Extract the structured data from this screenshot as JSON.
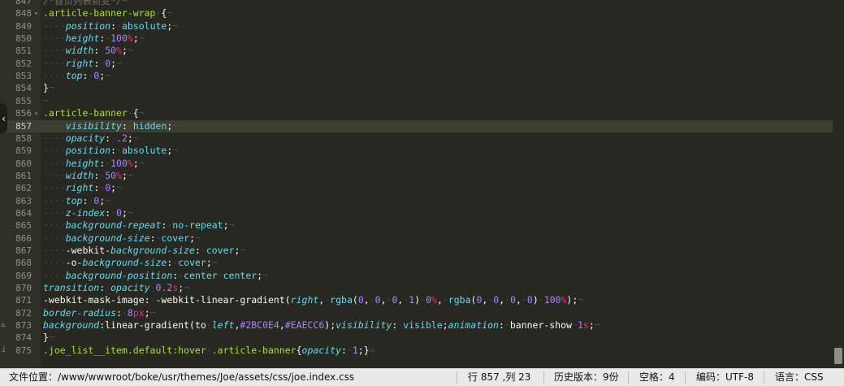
{
  "lines": [
    {
      "n": "847",
      "segs": [
        [
          "c-comment",
          "/*首页列表新变*/"
        ],
        [
          "c-ws",
          "¬"
        ]
      ]
    },
    {
      "n": "848",
      "fold": "▾",
      "segs": [
        [
          "c-sel",
          ".article-banner-wrap"
        ],
        [
          "c-ws",
          "·"
        ],
        [
          "c-plain",
          "{"
        ],
        [
          "c-ws",
          "¬"
        ]
      ]
    },
    {
      "n": "849",
      "segs": [
        [
          "c-ws",
          "····"
        ],
        [
          "c-prop",
          "position"
        ],
        [
          "c-plain",
          ":"
        ],
        [
          "c-ws",
          "·"
        ],
        [
          "c-val",
          "absolute"
        ],
        [
          "c-plain",
          ";"
        ],
        [
          "c-ws",
          "¬"
        ]
      ]
    },
    {
      "n": "850",
      "segs": [
        [
          "c-ws",
          "····"
        ],
        [
          "c-prop",
          "height"
        ],
        [
          "c-plain",
          ":"
        ],
        [
          "c-ws",
          "·"
        ],
        [
          "c-num",
          "100"
        ],
        [
          "c-unit",
          "%"
        ],
        [
          "c-plain",
          ";"
        ],
        [
          "c-ws",
          "¬"
        ]
      ]
    },
    {
      "n": "851",
      "segs": [
        [
          "c-ws",
          "····"
        ],
        [
          "c-prop",
          "width"
        ],
        [
          "c-plain",
          ":"
        ],
        [
          "c-ws",
          "·"
        ],
        [
          "c-num",
          "50"
        ],
        [
          "c-unit",
          "%"
        ],
        [
          "c-plain",
          ";"
        ],
        [
          "c-ws",
          "¬"
        ]
      ]
    },
    {
      "n": "852",
      "segs": [
        [
          "c-ws",
          "····"
        ],
        [
          "c-prop",
          "right"
        ],
        [
          "c-plain",
          ":"
        ],
        [
          "c-ws",
          "·"
        ],
        [
          "c-num",
          "0"
        ],
        [
          "c-plain",
          ";"
        ],
        [
          "c-ws",
          "¬"
        ]
      ]
    },
    {
      "n": "853",
      "segs": [
        [
          "c-ws",
          "····"
        ],
        [
          "c-prop",
          "top"
        ],
        [
          "c-plain",
          ":"
        ],
        [
          "c-ws",
          "·"
        ],
        [
          "c-num",
          "0"
        ],
        [
          "c-plain",
          ";"
        ],
        [
          "c-ws",
          "¬"
        ]
      ]
    },
    {
      "n": "854",
      "segs": [
        [
          "c-plain",
          "}"
        ],
        [
          "c-ws",
          "¬"
        ]
      ]
    },
    {
      "n": "855",
      "segs": [
        [
          "c-ws",
          "¬"
        ]
      ]
    },
    {
      "n": "856",
      "fold": "▾",
      "segs": [
        [
          "c-sel",
          ".article-banner"
        ],
        [
          "c-ws",
          "·"
        ],
        [
          "c-plain",
          "{"
        ],
        [
          "c-ws",
          "¬"
        ]
      ]
    },
    {
      "n": "857",
      "current": true,
      "segs": [
        [
          "c-ws",
          "····"
        ],
        [
          "c-prop",
          "visibility"
        ],
        [
          "c-plain",
          ":"
        ],
        [
          "c-ws",
          "·"
        ],
        [
          "c-val",
          "hidden"
        ],
        [
          "c-plain",
          ";"
        ],
        [
          "c-ws",
          "¬"
        ]
      ]
    },
    {
      "n": "858",
      "segs": [
        [
          "c-ws",
          "····"
        ],
        [
          "c-prop",
          "opacity"
        ],
        [
          "c-plain",
          ":"
        ],
        [
          "c-ws",
          "·"
        ],
        [
          "c-num",
          ".2"
        ],
        [
          "c-plain",
          ";"
        ],
        [
          "c-ws",
          "¬"
        ]
      ]
    },
    {
      "n": "859",
      "segs": [
        [
          "c-ws",
          "····"
        ],
        [
          "c-prop",
          "position"
        ],
        [
          "c-plain",
          ":"
        ],
        [
          "c-ws",
          "·"
        ],
        [
          "c-val",
          "absolute"
        ],
        [
          "c-plain",
          ";"
        ],
        [
          "c-ws",
          "¬"
        ]
      ]
    },
    {
      "n": "860",
      "segs": [
        [
          "c-ws",
          "····"
        ],
        [
          "c-prop",
          "height"
        ],
        [
          "c-plain",
          ":"
        ],
        [
          "c-ws",
          "·"
        ],
        [
          "c-num",
          "100"
        ],
        [
          "c-unit",
          "%"
        ],
        [
          "c-plain",
          ";"
        ],
        [
          "c-ws",
          "¬"
        ]
      ]
    },
    {
      "n": "861",
      "segs": [
        [
          "c-ws",
          "····"
        ],
        [
          "c-prop",
          "width"
        ],
        [
          "c-plain",
          ":"
        ],
        [
          "c-ws",
          "·"
        ],
        [
          "c-num",
          "50"
        ],
        [
          "c-unit",
          "%"
        ],
        [
          "c-plain",
          ";"
        ],
        [
          "c-ws",
          "¬"
        ]
      ]
    },
    {
      "n": "862",
      "segs": [
        [
          "c-ws",
          "····"
        ],
        [
          "c-prop",
          "right"
        ],
        [
          "c-plain",
          ":"
        ],
        [
          "c-ws",
          "·"
        ],
        [
          "c-num",
          "0"
        ],
        [
          "c-plain",
          ";"
        ],
        [
          "c-ws",
          "¬"
        ]
      ]
    },
    {
      "n": "863",
      "segs": [
        [
          "c-ws",
          "····"
        ],
        [
          "c-prop",
          "top"
        ],
        [
          "c-plain",
          ":"
        ],
        [
          "c-ws",
          "·"
        ],
        [
          "c-num",
          "0"
        ],
        [
          "c-plain",
          ";"
        ],
        [
          "c-ws",
          "¬"
        ]
      ]
    },
    {
      "n": "864",
      "segs": [
        [
          "c-ws",
          "····"
        ],
        [
          "c-prop",
          "z-index"
        ],
        [
          "c-plain",
          ":"
        ],
        [
          "c-ws",
          "·"
        ],
        [
          "c-num",
          "0"
        ],
        [
          "c-plain",
          ";"
        ],
        [
          "c-ws",
          "¬"
        ]
      ]
    },
    {
      "n": "865",
      "segs": [
        [
          "c-ws",
          "····"
        ],
        [
          "c-prop",
          "background-repeat"
        ],
        [
          "c-plain",
          ":"
        ],
        [
          "c-ws",
          "·"
        ],
        [
          "c-val",
          "no-repeat"
        ],
        [
          "c-plain",
          ";"
        ],
        [
          "c-ws",
          "¬"
        ]
      ]
    },
    {
      "n": "866",
      "segs": [
        [
          "c-ws",
          "····"
        ],
        [
          "c-prop",
          "background-size"
        ],
        [
          "c-plain",
          ":"
        ],
        [
          "c-ws",
          "·"
        ],
        [
          "c-val",
          "cover"
        ],
        [
          "c-plain",
          ";"
        ],
        [
          "c-ws",
          "¬"
        ]
      ]
    },
    {
      "n": "867",
      "segs": [
        [
          "c-ws",
          "····"
        ],
        [
          "c-plain",
          "-webkit-"
        ],
        [
          "c-prop",
          "background-size"
        ],
        [
          "c-plain",
          ":"
        ],
        [
          "c-ws",
          "·"
        ],
        [
          "c-val",
          "cover"
        ],
        [
          "c-plain",
          ";"
        ],
        [
          "c-ws",
          "¬"
        ]
      ]
    },
    {
      "n": "868",
      "segs": [
        [
          "c-ws",
          "····"
        ],
        [
          "c-plain",
          "-o-"
        ],
        [
          "c-prop",
          "background-size"
        ],
        [
          "c-plain",
          ":"
        ],
        [
          "c-ws",
          "·"
        ],
        [
          "c-val",
          "cover"
        ],
        [
          "c-plain",
          ";"
        ],
        [
          "c-ws",
          "¬"
        ]
      ]
    },
    {
      "n": "869",
      "segs": [
        [
          "c-ws",
          "····"
        ],
        [
          "c-prop",
          "background-position"
        ],
        [
          "c-plain",
          ":"
        ],
        [
          "c-ws",
          "·"
        ],
        [
          "c-val",
          "center"
        ],
        [
          "c-ws",
          "·"
        ],
        [
          "c-val",
          "center"
        ],
        [
          "c-plain",
          ";"
        ],
        [
          "c-ws",
          "¬"
        ]
      ]
    },
    {
      "n": "870",
      "segs": [
        [
          "c-prop",
          "transition"
        ],
        [
          "c-plain",
          ":"
        ],
        [
          "c-ws",
          "·"
        ],
        [
          "c-prop",
          "opacity"
        ],
        [
          "c-ws",
          "·"
        ],
        [
          "c-num",
          "0.2"
        ],
        [
          "c-unit",
          "s"
        ],
        [
          "c-plain",
          ";"
        ],
        [
          "c-ws",
          "¬"
        ]
      ]
    },
    {
      "n": "871",
      "segs": [
        [
          "c-plain",
          "-webkit-mask-image:"
        ],
        [
          "c-ws",
          "·"
        ],
        [
          "c-plain",
          "-webkit-linear-gradient("
        ],
        [
          "c-prop",
          "right"
        ],
        [
          "c-plain",
          ","
        ],
        [
          "c-ws",
          "·"
        ],
        [
          "c-val",
          "rgba"
        ],
        [
          "c-plain",
          "("
        ],
        [
          "c-num",
          "0"
        ],
        [
          "c-plain",
          ","
        ],
        [
          "c-ws",
          "·"
        ],
        [
          "c-num",
          "0"
        ],
        [
          "c-plain",
          ","
        ],
        [
          "c-ws",
          "·"
        ],
        [
          "c-num",
          "0"
        ],
        [
          "c-plain",
          ","
        ],
        [
          "c-ws",
          "·"
        ],
        [
          "c-num",
          "1"
        ],
        [
          "c-plain",
          ")"
        ],
        [
          "c-ws",
          "·"
        ],
        [
          "c-num",
          "0"
        ],
        [
          "c-unit",
          "%"
        ],
        [
          "c-plain",
          ","
        ],
        [
          "c-ws",
          "·"
        ],
        [
          "c-val",
          "rgba"
        ],
        [
          "c-plain",
          "("
        ],
        [
          "c-num",
          "0"
        ],
        [
          "c-plain",
          ","
        ],
        [
          "c-ws",
          "·"
        ],
        [
          "c-num",
          "0"
        ],
        [
          "c-plain",
          ","
        ],
        [
          "c-ws",
          "·"
        ],
        [
          "c-num",
          "0"
        ],
        [
          "c-plain",
          ","
        ],
        [
          "c-ws",
          "·"
        ],
        [
          "c-num",
          "0"
        ],
        [
          "c-plain",
          ")"
        ],
        [
          "c-ws",
          "·"
        ],
        [
          "c-num",
          "100"
        ],
        [
          "c-unit",
          "%"
        ],
        [
          "c-plain",
          ");"
        ],
        [
          "c-ws",
          "¬"
        ]
      ]
    },
    {
      "n": "872",
      "segs": [
        [
          "c-prop",
          "border-radius"
        ],
        [
          "c-plain",
          ":"
        ],
        [
          "c-ws",
          "·"
        ],
        [
          "c-num",
          "8"
        ],
        [
          "c-unit",
          "px"
        ],
        [
          "c-plain",
          ";"
        ],
        [
          "c-ws",
          "¬"
        ]
      ]
    },
    {
      "n": "873",
      "warn": "⚠",
      "segs": [
        [
          "c-prop",
          "background"
        ],
        [
          "c-plain",
          ":linear-gradient(to"
        ],
        [
          "c-ws",
          "·"
        ],
        [
          "c-prop",
          "left"
        ],
        [
          "c-plain",
          ","
        ],
        [
          "c-num",
          "#2BC0E4"
        ],
        [
          "c-plain",
          ","
        ],
        [
          "c-num",
          "#EAECC6"
        ],
        [
          "c-plain",
          ");"
        ],
        [
          "c-prop",
          "visibility"
        ],
        [
          "c-plain",
          ":"
        ],
        [
          "c-ws",
          "·"
        ],
        [
          "c-val",
          "visible"
        ],
        [
          "c-plain",
          ";"
        ],
        [
          "c-prop",
          "animation"
        ],
        [
          "c-plain",
          ":"
        ],
        [
          "c-ws",
          "·"
        ],
        [
          "c-plain",
          "banner-show"
        ],
        [
          "c-ws",
          "·"
        ],
        [
          "c-num",
          "1"
        ],
        [
          "c-unit",
          "s"
        ],
        [
          "c-plain",
          ";"
        ],
        [
          "c-ws",
          "¬"
        ]
      ]
    },
    {
      "n": "874",
      "segs": [
        [
          "c-plain",
          "}"
        ],
        [
          "c-ws",
          "¬"
        ]
      ]
    },
    {
      "n": "875",
      "info": "i",
      "segs": [
        [
          "c-sel",
          ".joe_list__item.default:hover"
        ],
        [
          "c-ws",
          "·"
        ],
        [
          "c-sel",
          ".article-banner"
        ],
        [
          "c-plain",
          "{"
        ],
        [
          "c-prop",
          "opacity"
        ],
        [
          "c-plain",
          ":"
        ],
        [
          "c-ws",
          "·"
        ],
        [
          "c-num",
          "1"
        ],
        [
          "c-plain",
          ";}"
        ],
        [
          "c-ws",
          "¤"
        ]
      ]
    }
  ],
  "status": {
    "file_path": "文件位置：/www/wwwroot/boke/usr/themes/Joe/assets/css/joe.index.css",
    "cursor": "行 857 ,列 23",
    "history": "历史版本：9份",
    "indent": "空格：4",
    "encoding": "编码：UTF-8",
    "language": "语言：CSS"
  },
  "collapse_icon": "‹",
  "colors": {
    "background": "#272822",
    "gutter": "#2f3129",
    "current_line": "#3e3d32",
    "selector": "#a6e22e",
    "property": "#66d9ef",
    "number": "#ae81ff",
    "unit": "#f92672",
    "comment": "#75715e",
    "status_bar": "#e9e9e9"
  }
}
